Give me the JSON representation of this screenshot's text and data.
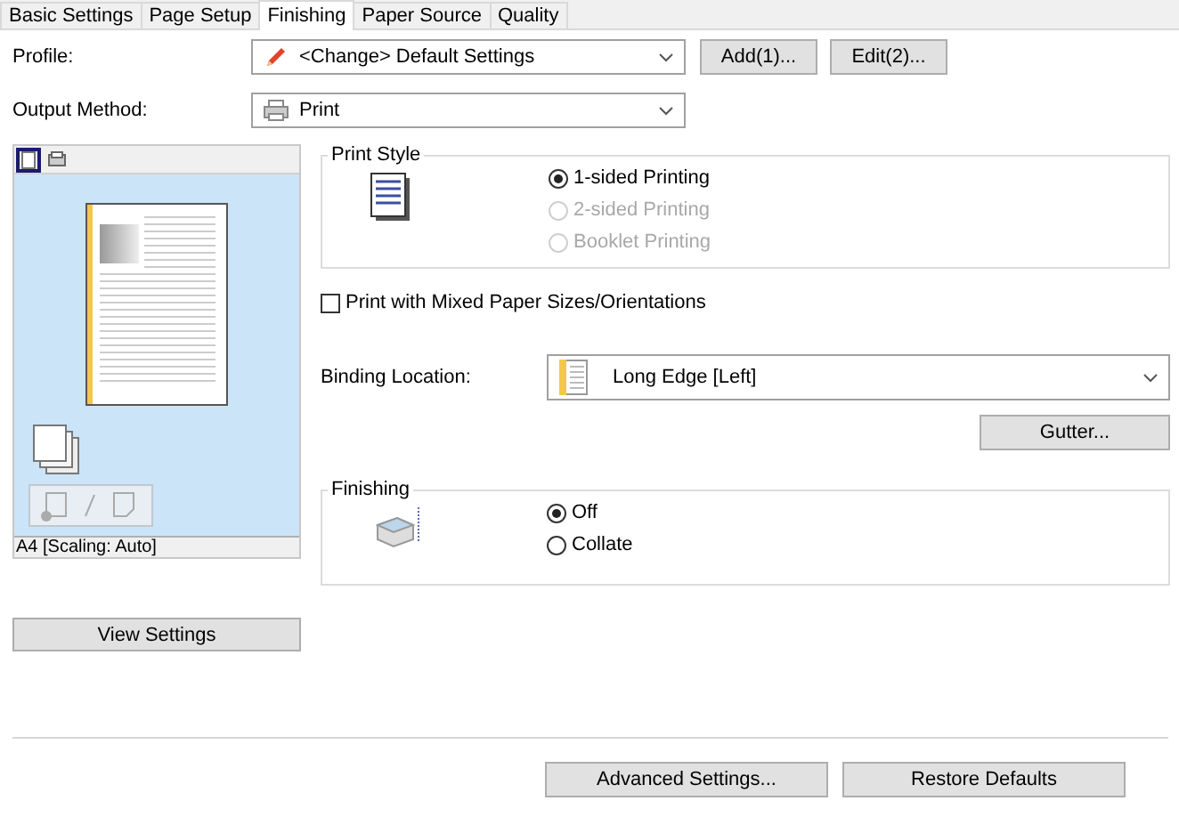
{
  "tabs": [
    {
      "label": "Basic Settings",
      "selected": false
    },
    {
      "label": "Page Setup",
      "selected": false
    },
    {
      "label": "Finishing",
      "selected": true
    },
    {
      "label": "Paper Source",
      "selected": false
    },
    {
      "label": "Quality",
      "selected": false
    }
  ],
  "profile": {
    "label": "Profile:",
    "value": "<Change> Default Settings",
    "buttons": [
      "Add(1)...",
      "Edit(2)..."
    ]
  },
  "output_method": {
    "label": "Output Method:",
    "value": "Print"
  },
  "preview": {
    "views": [
      {
        "kind": "page",
        "selected": true
      },
      {
        "kind": "printer",
        "selected": false
      }
    ],
    "status": "A4 [Scaling: Auto]"
  },
  "view_settings_button": "View Settings",
  "print_style": {
    "title": "Print Style",
    "options": [
      {
        "label": "1-sided Printing",
        "selected": true,
        "disabled": false
      },
      {
        "label": "2-sided Printing",
        "selected": false,
        "disabled": true
      },
      {
        "label": "Booklet Printing",
        "selected": false,
        "disabled": true
      }
    ]
  },
  "mixed_sizes": {
    "label": "Print with Mixed Paper Sizes/Orientations",
    "checked": false
  },
  "binding": {
    "label": "Binding Location:",
    "value": "Long Edge [Left]"
  },
  "gutter_button": "Gutter...",
  "finishing": {
    "title": "Finishing",
    "options": [
      {
        "label": "Off",
        "selected": true,
        "disabled": false
      },
      {
        "label": "Collate",
        "selected": false,
        "disabled": false
      }
    ]
  },
  "footer_buttons": [
    "Advanced Settings...",
    "Restore Defaults"
  ]
}
